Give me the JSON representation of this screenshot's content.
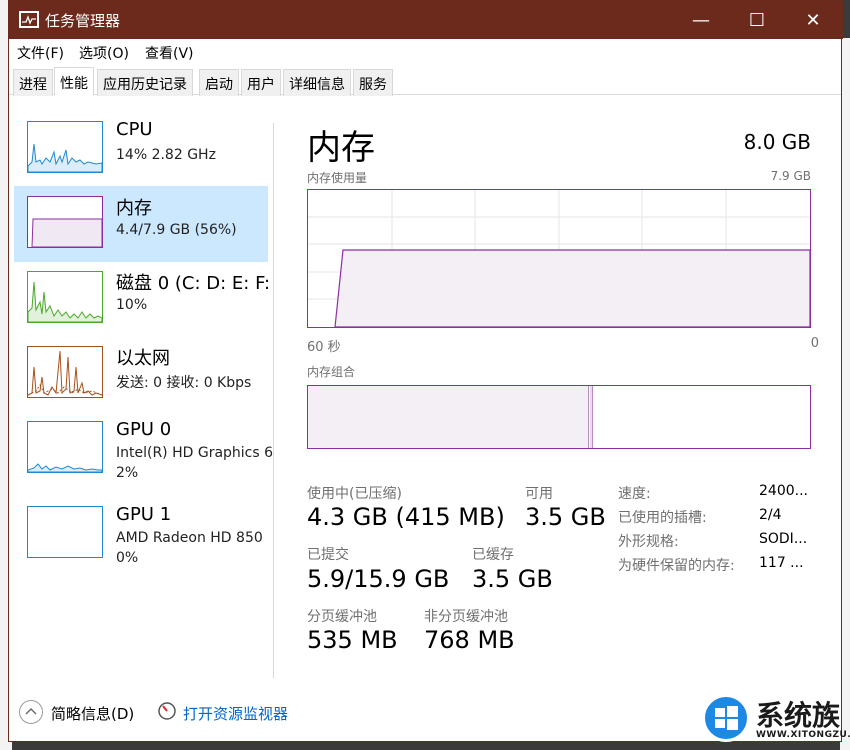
{
  "window": {
    "title": "任务管理器",
    "minimize": "—",
    "maximize": "☐",
    "close": "✕"
  },
  "menu": {
    "file": "文件(F)",
    "options": "选项(O)",
    "view": "查看(V)"
  },
  "tabs": [
    {
      "label": "进程"
    },
    {
      "label": "性能"
    },
    {
      "label": "应用历史记录"
    },
    {
      "label": "启动"
    },
    {
      "label": "用户"
    },
    {
      "label": "详细信息"
    },
    {
      "label": "服务"
    }
  ],
  "sidebar": {
    "items": [
      {
        "title": "CPU",
        "sub1": "14% 2.82 GHz",
        "sub2": ""
      },
      {
        "title": "内存",
        "sub1": "4.4/7.9 GB (56%)",
        "sub2": ""
      },
      {
        "title": "磁盘 0 (C: D: E: F:",
        "sub1": "10%",
        "sub2": ""
      },
      {
        "title": "以太网",
        "sub1": "发送: 0 接收: 0 Kbps",
        "sub2": ""
      },
      {
        "title": "GPU 0",
        "sub1": "Intel(R) HD Graphics 6",
        "sub2": "2%"
      },
      {
        "title": "GPU 1",
        "sub1": "AMD Radeon HD 850",
        "sub2": "0%"
      }
    ]
  },
  "main": {
    "title": "内存",
    "total": "8.0 GB",
    "usage_label": "内存使用量",
    "usage_max": "7.9 GB",
    "axis_left": "60 秒",
    "axis_right": "0",
    "composition_label": "内存组合",
    "usage_fraction": 0.56,
    "in_use_label": "使用中(已压缩)",
    "in_use_value": "4.3 GB (415 MB)",
    "available_label": "可用",
    "available_value": "3.5 GB",
    "committed_label": "已提交",
    "committed_value": "5.9/15.9 GB",
    "cached_label": "已缓存",
    "cached_value": "3.5 GB",
    "paged_label": "分页缓冲池",
    "paged_value": "535 MB",
    "nonpaged_label": "非分页缓冲池",
    "nonpaged_value": "768 MB",
    "speed_label": "速度:",
    "speed_value": "2400...",
    "slots_label": "已使用的插槽:",
    "slots_value": "2/4",
    "form_label": "外形规格:",
    "form_value": "SODI...",
    "reserved_label": "为硬件保留的内存:",
    "reserved_value": "117 ..."
  },
  "footer": {
    "summary": "简略信息(D)",
    "monitor": "打开资源监视器"
  },
  "watermark": {
    "text": "系统族",
    "url": "WWW.XITONGZU.COM"
  },
  "colors": {
    "titlebar": "#6b2a1c",
    "memory_accent": "#8b2fa0",
    "selected": "#cce8ff",
    "link": "#0066cc"
  }
}
